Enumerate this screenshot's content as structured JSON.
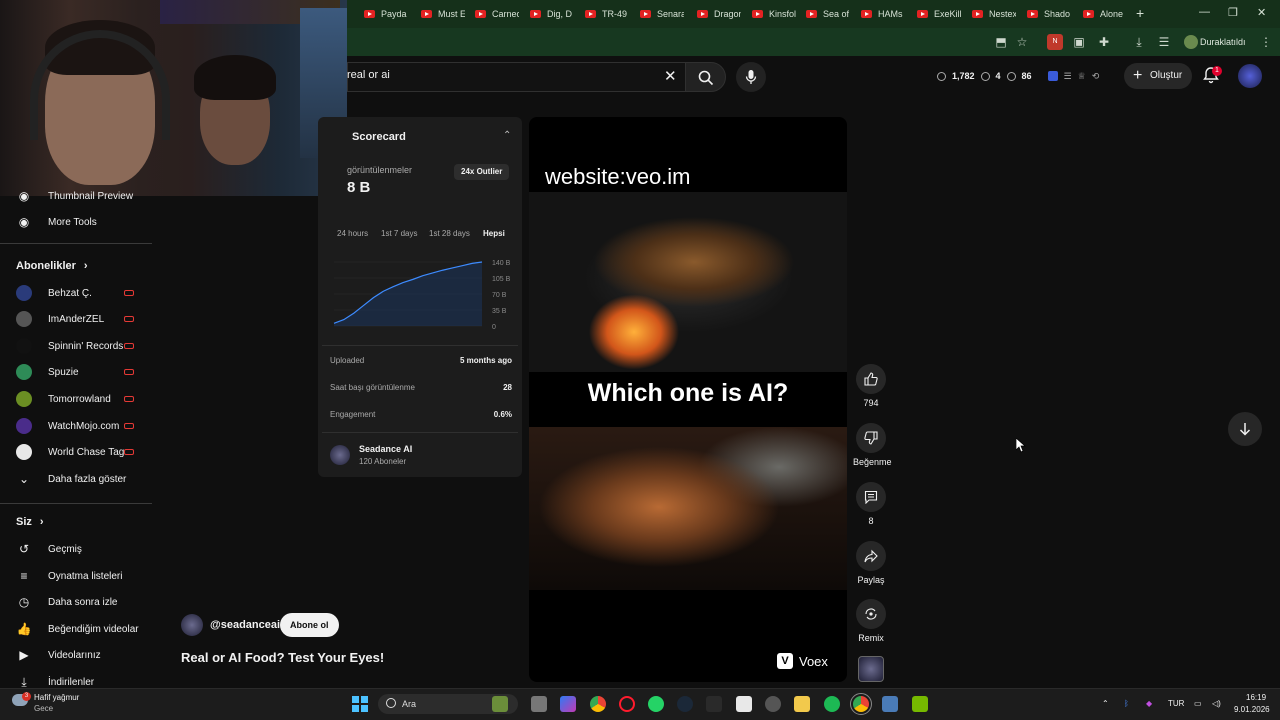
{
  "browser": {
    "tabs": [
      "Payda",
      "Must E",
      "Carnec",
      "Dig, D",
      "TR-49",
      "Senara",
      "Dragon",
      "Kinsfol",
      "Sea of",
      "HAMs",
      "ExeKill",
      "Nestex",
      "Shado",
      "Alone"
    ],
    "new_tab": "+",
    "profile_status": "Duraklatıldı",
    "window_controls": [
      "—",
      "❐",
      "✕"
    ]
  },
  "search": {
    "query": "real or ai"
  },
  "topbar": {
    "stats": {
      "views": "1,782",
      "likes": "4",
      "watching": "86"
    },
    "create_label": "Oluştur",
    "notification_count": "1"
  },
  "sidebar": {
    "tool_items": [
      {
        "label": "Thumbnail Preview",
        "icon": "thumbnail-icon"
      },
      {
        "label": "More Tools",
        "icon": "tools-icon"
      }
    ],
    "subscriptions_heading": "Abonelikler",
    "subscriptions": [
      {
        "label": "Behzat Ç.",
        "color": "#2a3b7a"
      },
      {
        "label": "ImAnderZEL",
        "color": "#555555"
      },
      {
        "label": "Spinnin' Records",
        "color": "#111111"
      },
      {
        "label": "Spuzie",
        "color": "#2e8b57"
      },
      {
        "label": "Tomorrowland",
        "color": "#6b8e23"
      },
      {
        "label": "WatchMojo.com",
        "color": "#4a2c8a"
      },
      {
        "label": "World Chase Tag",
        "color": "#e8e8e8"
      }
    ],
    "show_more": "Daha fazla göster",
    "you_heading": "Siz",
    "you_items": [
      {
        "label": "Geçmiş",
        "icon": "history-icon"
      },
      {
        "label": "Oynatma listeleri",
        "icon": "playlists-icon"
      },
      {
        "label": "Daha sonra izle",
        "icon": "watch-later-icon"
      },
      {
        "label": "Beğendiğim videolar",
        "icon": "liked-icon"
      },
      {
        "label": "Videolarınız",
        "icon": "your-videos-icon"
      },
      {
        "label": "İndirilenler",
        "icon": "downloads-icon"
      }
    ]
  },
  "scorecard": {
    "title": "Scorecard",
    "views_label": "görüntülenmeler",
    "views_value": "8 B",
    "outlier_badge": "24x Outlier",
    "periods": [
      "24 hours",
      "1st 7 days",
      "1st 28 days",
      "Hepsi"
    ],
    "active_period": "Hepsi",
    "chart_data": {
      "type": "area",
      "y_ticks": [
        "140 B",
        "105 B",
        "70 B",
        "35 B",
        "0"
      ],
      "ylim": [
        0,
        140
      ],
      "series": [
        {
          "values": [
            6,
            14,
            28,
            45,
            62,
            76,
            86,
            95,
            102,
            110,
            116,
            122,
            127,
            132,
            137,
            140
          ]
        }
      ]
    },
    "rows": [
      {
        "label": "Uploaded",
        "value": "5 months ago"
      },
      {
        "label": "Saat başı görüntülenme",
        "value": "28"
      },
      {
        "label": "Engagement",
        "value": "0.6%"
      }
    ],
    "channel_name": "Seadance AI",
    "channel_subs": "120 Aboneler"
  },
  "video": {
    "overlay_website": "website:veo.im",
    "overlay_question": "Which one is AI?",
    "watermark": "Voex",
    "channel_handle": "@seadanceai",
    "subscribe_label": "Abone ol",
    "title": "Real or AI Food? Test Your Eyes!"
  },
  "actions": {
    "like_count": "794",
    "dislike_label": "Beğenme",
    "comment_count": "8",
    "share_label": "Paylaş",
    "remix_label": "Remix"
  },
  "taskbar": {
    "weather_badge": "3",
    "weather_temp": "Hafif yağmur",
    "weather_desc": "Gece",
    "search_label": "Ara",
    "language": "TUR",
    "time": "16:19",
    "date": "9.01.2026"
  }
}
